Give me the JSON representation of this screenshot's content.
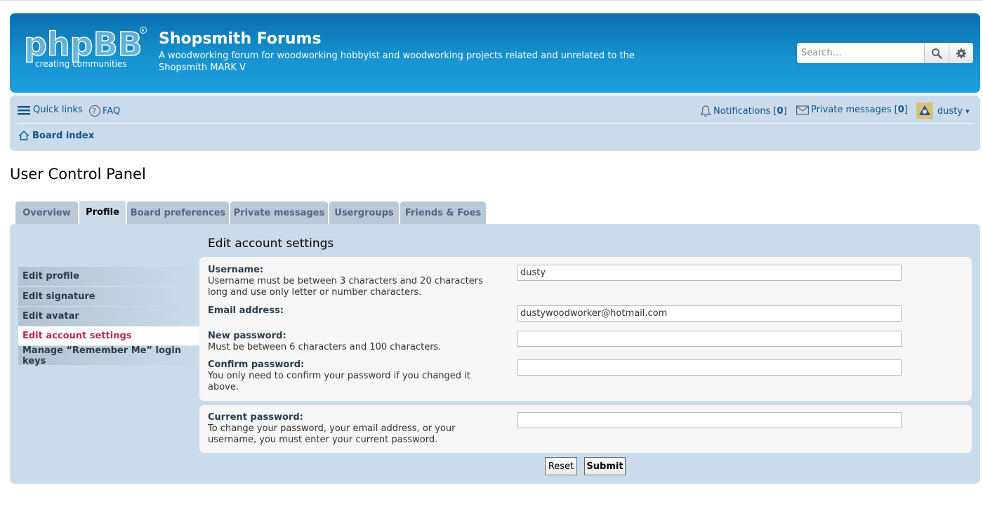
{
  "header": {
    "logo_text": "phpBB",
    "logo_tagline": "creating communities",
    "title": "Shopsmith Forums",
    "description": "A woodworking forum for woodworking hobbyist and woodworking projects related and unrelated to the Shopsmith MARK V",
    "search_placeholder": "Search…",
    "search_icon": "magnifier-icon",
    "advanced_icon": "gear-icon"
  },
  "navbar": {
    "quick_links": "Quick links",
    "faq": "FAQ",
    "notifications_label": "Notifications",
    "notifications_open": "[",
    "notifications_count": "0",
    "notifications_close": "]",
    "pm_label": "Private messages",
    "pm_open": "[",
    "pm_count": "0",
    "pm_close": "]",
    "username": "dusty",
    "user_caret": "▾",
    "board_index": "Board index"
  },
  "page_title": "User Control Panel",
  "tabs": [
    {
      "label": "Overview"
    },
    {
      "label": "Profile",
      "active": true
    },
    {
      "label": "Board preferences"
    },
    {
      "label": "Private messages"
    },
    {
      "label": "Usergroups"
    },
    {
      "label": "Friends & Foes"
    }
  ],
  "sidemenu": [
    {
      "label": "Edit profile"
    },
    {
      "label": "Edit signature"
    },
    {
      "label": "Edit avatar"
    },
    {
      "label": "Edit account settings",
      "active": true
    },
    {
      "label": "Manage “Remember Me” login keys"
    }
  ],
  "form": {
    "heading": "Edit account settings",
    "username": {
      "label": "Username:",
      "explain": "Username must be between 3 characters and 20 characters long and use only letter or number characters.",
      "value": "dusty"
    },
    "email": {
      "label": "Email address:",
      "value": "dustywoodworker@hotmail.com"
    },
    "new_password": {
      "label": "New password:",
      "explain": "Must be between 6 characters and 100 characters.",
      "value": ""
    },
    "confirm_password": {
      "label": "Confirm password:",
      "explain": "You only need to confirm your password if you changed it above.",
      "value": ""
    },
    "current_password": {
      "label": "Current password:",
      "explain": "To change your password, your email address, or your username, you must enter your current password.",
      "value": ""
    },
    "reset_label": "Reset",
    "submit_label": "Submit"
  },
  "colors": {
    "header_blue": "#1692cf",
    "nav_bg": "#cadceb",
    "link": "#105289",
    "active_menu": "#bc2a4d"
  }
}
